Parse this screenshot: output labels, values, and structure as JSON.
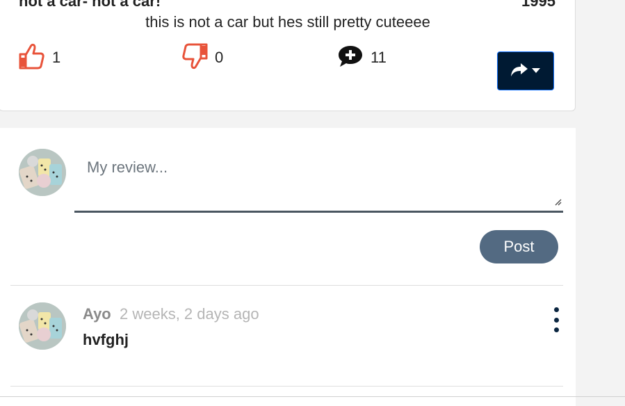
{
  "post": {
    "title": "not a car- not a car!",
    "year": "1995",
    "caption": "this is not a car but hes still pretty cuteeee",
    "likes": "1",
    "dislikes": "0",
    "comments": "11",
    "icons": {
      "like": "thumbs-up-icon",
      "dislike": "thumbs-down-icon",
      "comment": "comment-plus-icon",
      "share": "share-icon",
      "caret": "caret-down-icon"
    },
    "colors": {
      "reaction": "#e8533a",
      "share_bg": "#001a33",
      "share_border": "#0d6efd"
    }
  },
  "review_form": {
    "placeholder": "My review...",
    "post_label": "Post",
    "post_color": "#536a82"
  },
  "comments": [
    {
      "author": "Ayo",
      "time": "2 weeks, 2 days ago",
      "text": "hvfghj"
    }
  ]
}
